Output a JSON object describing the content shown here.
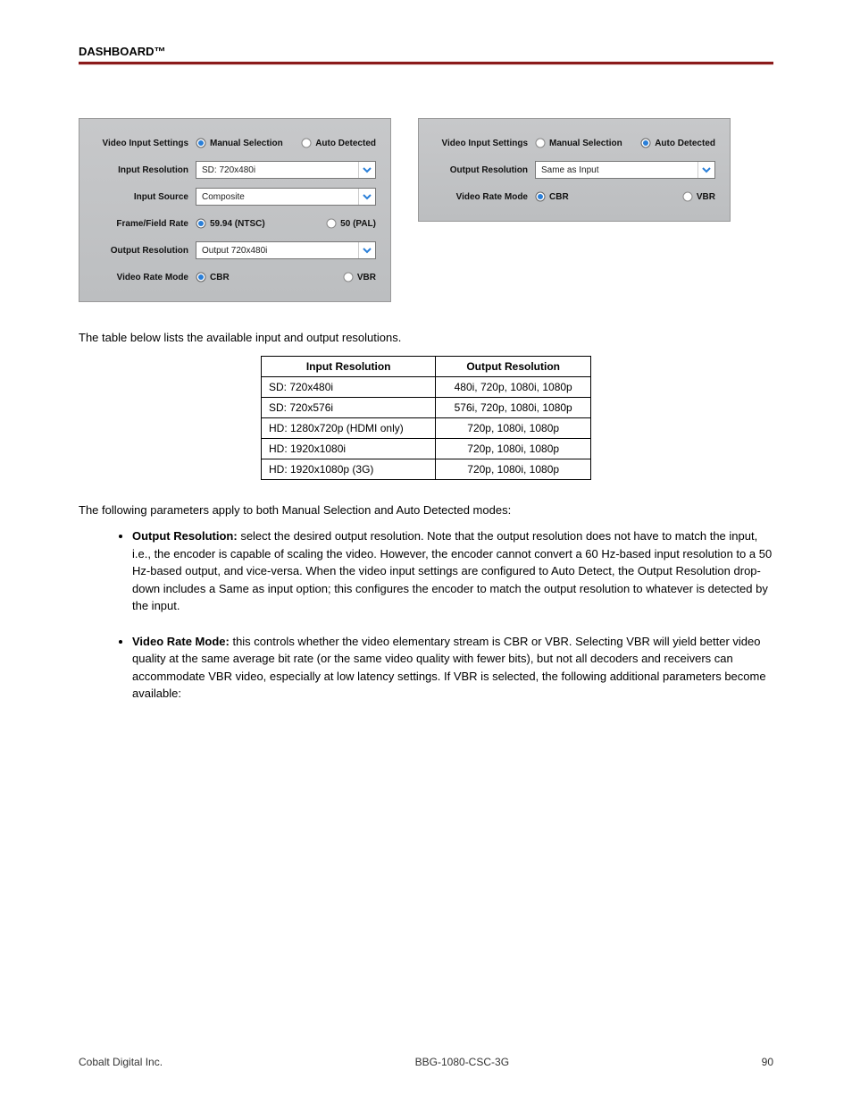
{
  "header": {
    "title": "DASHBOARD™"
  },
  "footer": {
    "company": "Cobalt Digital Inc.",
    "product": "BBG-1080-CSC-3G",
    "page": "90"
  },
  "panels": {
    "left": {
      "video_input_settings": {
        "label": "Video Input Settings",
        "opt1": "Manual Selection",
        "opt2": "Auto Detected",
        "selected": 1
      },
      "input_resolution": {
        "label": "Input Resolution",
        "value": "SD: 720x480i"
      },
      "input_source": {
        "label": "Input Source",
        "value": "Composite"
      },
      "frame_field_rate": {
        "label": "Frame/Field Rate",
        "opt1": "59.94 (NTSC)",
        "opt2": "50 (PAL)",
        "selected": 1
      },
      "output_resolution": {
        "label": "Output Resolution",
        "value": "Output 720x480i"
      },
      "video_rate_mode": {
        "label": "Video Rate Mode",
        "opt1": "CBR",
        "opt2": "VBR",
        "selected": 1
      }
    },
    "right": {
      "video_input_settings": {
        "label": "Video Input Settings",
        "opt1": "Manual Selection",
        "opt2": "Auto Detected",
        "selected": 2
      },
      "output_resolution": {
        "label": "Output Resolution",
        "value": "Same as Input"
      },
      "video_rate_mode": {
        "label": "Video Rate Mode",
        "opt1": "CBR",
        "opt2": "VBR",
        "selected": 1
      }
    }
  },
  "intro": "The table below lists the available input and output resolutions.",
  "table": {
    "headers": [
      "Input Resolution",
      "Output Resolution"
    ],
    "rows": [
      [
        "SD: 720x480i",
        "480i, 720p, 1080i, 1080p"
      ],
      [
        "SD: 720x576i",
        "576i, 720p, 1080i, 1080p"
      ],
      [
        "HD: 1280x720p (HDMI only)",
        "720p, 1080i, 1080p"
      ],
      [
        "HD: 1920x1080i",
        "720p, 1080i, 1080p"
      ],
      [
        "HD: 1920x1080p (3G)",
        "720p, 1080i, 1080p"
      ]
    ]
  },
  "section_lead": "The following parameters apply to both Manual Selection and Auto Detected modes:",
  "bullets": [
    {
      "lead": "Output Resolution:",
      "body": " select the desired output resolution. Note that the output resolution does not have to match the input, i.e., the encoder is capable of scaling the video. However, the encoder cannot convert a 60 Hz-based input resolution to a 50 Hz-based output, and vice-versa. When the video input settings are configured to Auto Detect, the Output Resolution drop-down includes a Same as input option; this configures the encoder to match the output resolution to whatever is detected by the input."
    },
    {
      "lead": "Video Rate Mode:",
      "body": " this controls whether the video elementary stream is CBR or VBR. Selecting VBR will yield better video quality at the same average bit rate (or the same video quality with fewer bits), but not all decoders and receivers can accommodate VBR video, especially at low latency settings. If VBR is selected, the following additional parameters become available:"
    }
  ]
}
